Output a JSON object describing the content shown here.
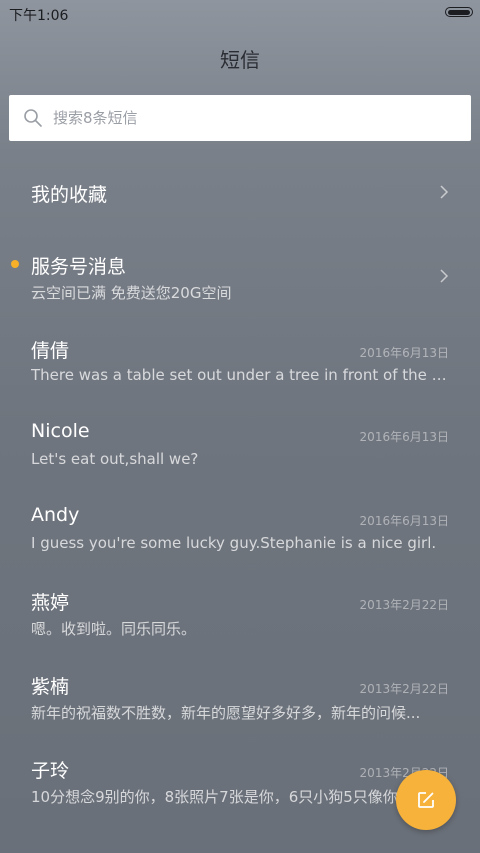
{
  "status_bar": {
    "time": "下午1:06",
    "battery_icon": "battery-icon"
  },
  "header": {
    "title": "短信"
  },
  "search": {
    "placeholder": "搜索8条短信",
    "icon": "search-icon"
  },
  "favorites": {
    "label": "我的收藏",
    "icon": "chevron-right-icon"
  },
  "service": {
    "label": "服务号消息",
    "preview": "云空间已满 免费送您20G空间",
    "unread_color": "#f7b027",
    "icon": "chevron-right-icon"
  },
  "conversations": [
    {
      "name": "倩倩",
      "date": "2016年6月13日",
      "preview": "There was a table set out under a tree in front of the ho..."
    },
    {
      "name": "Nicole",
      "date": "2016年6月13日",
      "preview": "Let's eat out,shall we?"
    },
    {
      "name": "Andy",
      "date": "2016年6月13日",
      "preview": "I guess you're some lucky guy.Stephanie is a nice girl."
    },
    {
      "name": "燕婷",
      "date": "2013年2月22日",
      "preview": "嗯。收到啦。同乐同乐。"
    },
    {
      "name": "紫楠",
      "date": "2013年2月22日",
      "preview": "新年的祝福数不胜数，新年的愿望好多好多，新年的问候..."
    },
    {
      "name": "子玲",
      "date": "2013年2月22日",
      "preview": "10分想念9别的你，8张照片7张是你，6只小狗5只像你"
    }
  ],
  "fab": {
    "icon": "compose-icon",
    "color": "#f6b23a"
  }
}
